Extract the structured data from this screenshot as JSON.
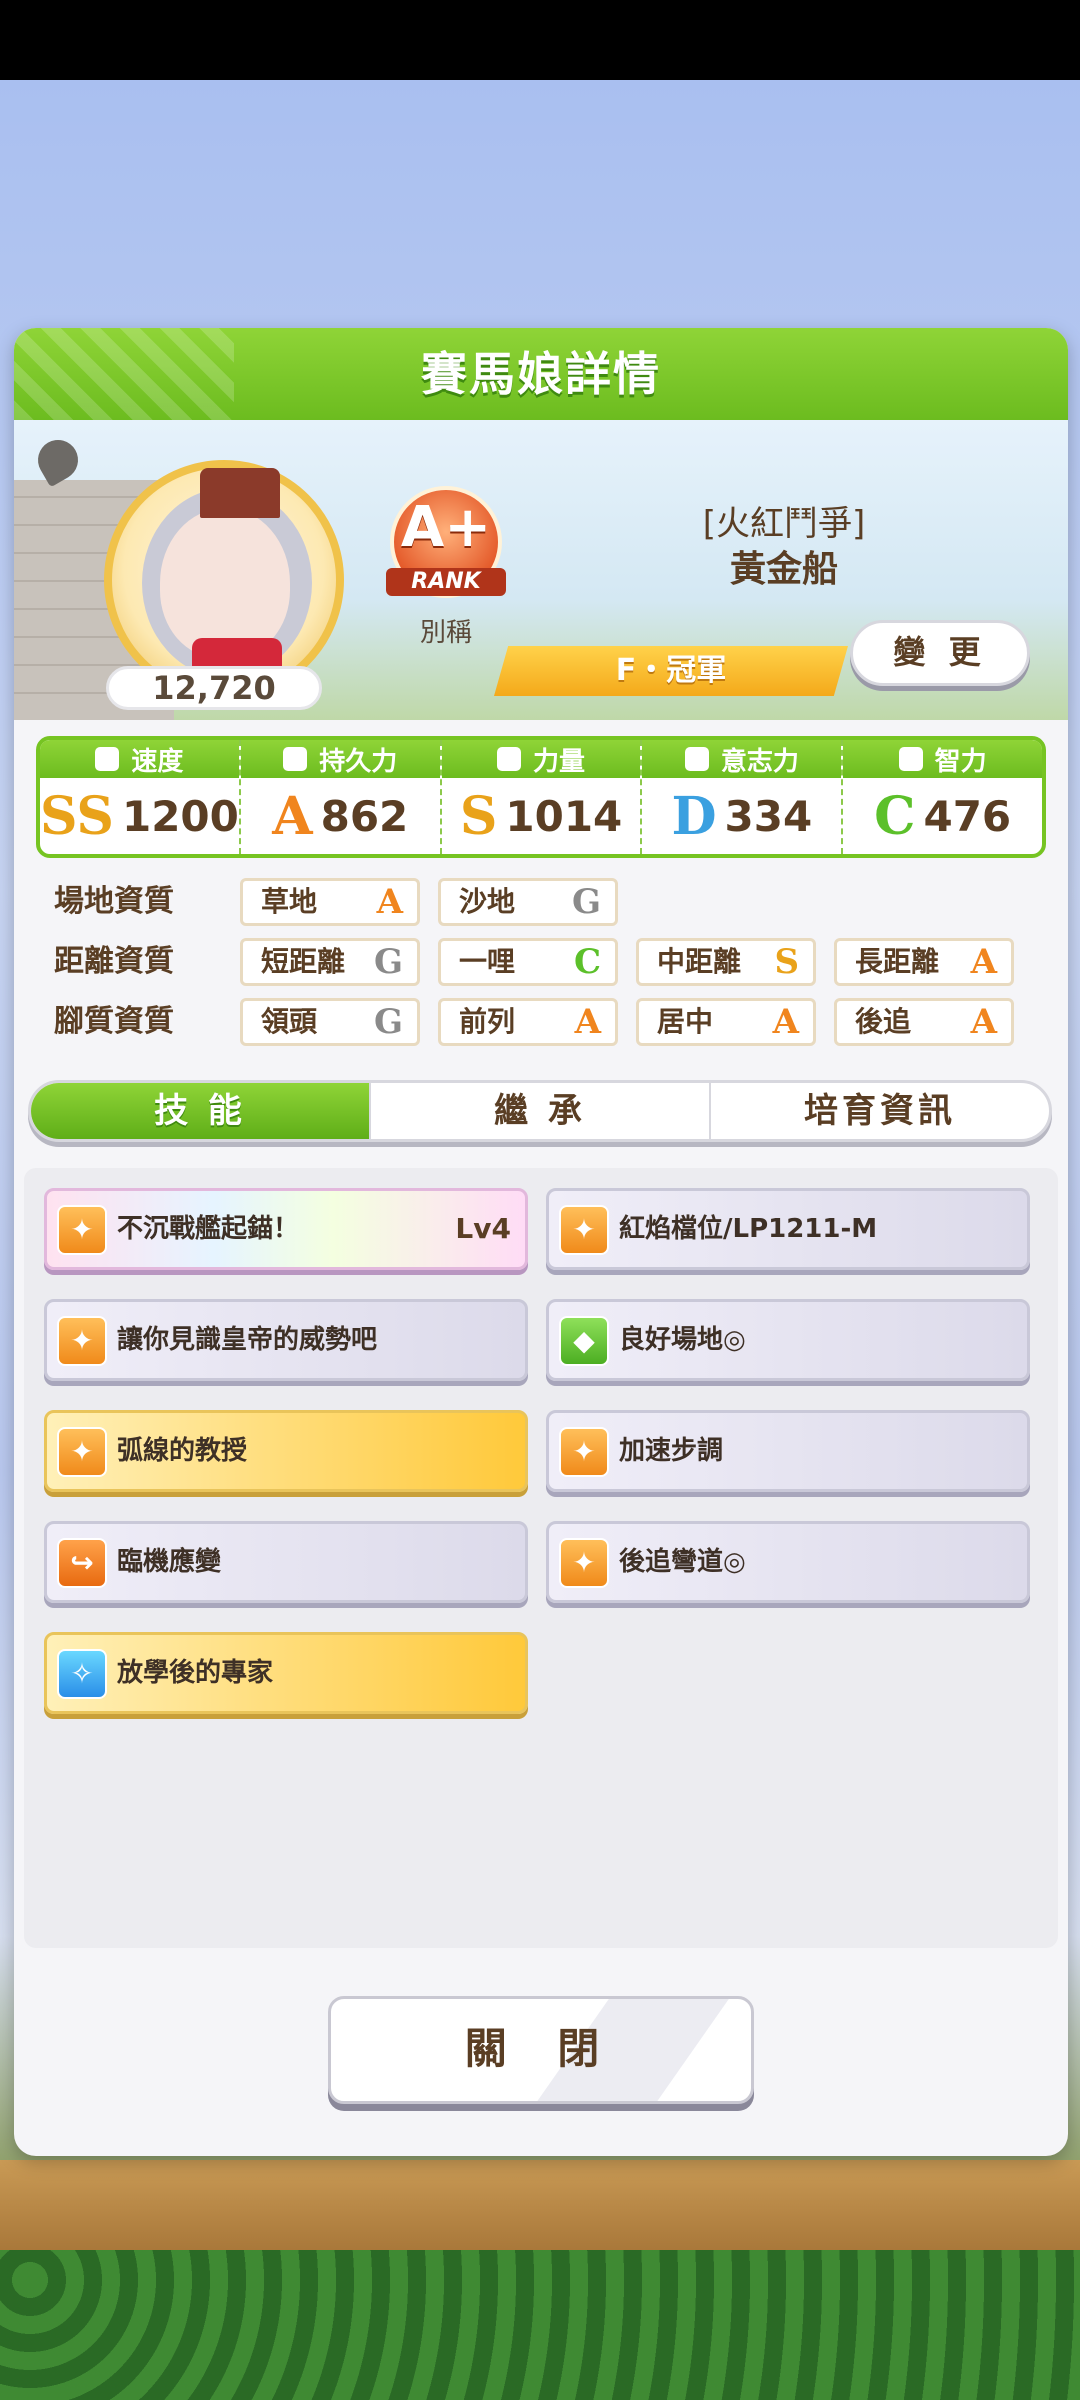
{
  "dialog": {
    "title": "賽馬娘詳情",
    "character": {
      "score": "12,720",
      "rank_grade": "A+",
      "rank_word": "RANK",
      "rank_label": "別稱",
      "epithet": "[火紅鬥爭]",
      "name": "黃金船",
      "title_badge": "F・冠軍",
      "change_button": "變 更"
    },
    "stats": [
      {
        "name": "速度",
        "grade": "SS",
        "value": "1200",
        "grade_color": "#e9a21a",
        "icon": "shoe-icon"
      },
      {
        "name": "持久力",
        "grade": "A",
        "value": "862",
        "grade_color": "#f0851e",
        "icon": "heart-icon"
      },
      {
        "name": "力量",
        "grade": "S",
        "value": "1014",
        "grade_color": "#e9a21a",
        "icon": "muscle-icon"
      },
      {
        "name": "意志力",
        "grade": "D",
        "value": "334",
        "grade_color": "#3aa0e0",
        "icon": "flame-icon"
      },
      {
        "name": "智力",
        "grade": "C",
        "value": "476",
        "grade_color": "#5cc02a",
        "icon": "graduation-cap-icon"
      }
    ],
    "aptitudes": {
      "field": {
        "label": "場地資質",
        "items": [
          {
            "name": "草地",
            "grade": "A"
          },
          {
            "name": "沙地",
            "grade": "G"
          }
        ]
      },
      "distance": {
        "label": "距離資質",
        "items": [
          {
            "name": "短距離",
            "grade": "G"
          },
          {
            "name": "一哩",
            "grade": "C"
          },
          {
            "name": "中距離",
            "grade": "S"
          },
          {
            "name": "長距離",
            "grade": "A"
          }
        ]
      },
      "style": {
        "label": "腳質資質",
        "items": [
          {
            "name": "領頭",
            "grade": "G"
          },
          {
            "name": "前列",
            "grade": "A"
          },
          {
            "name": "居中",
            "grade": "A"
          },
          {
            "name": "後追",
            "grade": "A"
          }
        ]
      }
    },
    "grade_colors": {
      "A": "#f0851e",
      "G": "#8a8a8a",
      "C": "#5cc02a",
      "S": "#e9a21a"
    },
    "tabs": [
      "技 能",
      "繼 承",
      "培育資訊"
    ],
    "skills": [
      {
        "name": "不沉戰艦起錨！",
        "level": "Lv4",
        "style": "rainbow",
        "icon": "runner-icon"
      },
      {
        "name": "紅焰檔位/LP1211-M",
        "level": "",
        "style": "normal",
        "icon": "runner-icon"
      },
      {
        "name": "讓你見識皇帝的威勢吧",
        "level": "",
        "style": "normal",
        "icon": "runner-icon"
      },
      {
        "name": "良好場地◎",
        "level": "",
        "style": "normal",
        "icon": "muscle-icon"
      },
      {
        "name": "弧線的教授",
        "level": "",
        "style": "gold",
        "icon": "runner-icon"
      },
      {
        "name": "加速步調",
        "level": "",
        "style": "normal",
        "icon": "runner-icon"
      },
      {
        "name": "臨機應變",
        "level": "",
        "style": "normal",
        "icon": "arrow-turn-icon"
      },
      {
        "name": "後追彎道◎",
        "level": "",
        "style": "normal",
        "icon": "runner-icon"
      },
      {
        "name": "放學後的專家",
        "level": "",
        "style": "gold",
        "icon": "sparkle-icon"
      }
    ],
    "close_button": "關 閉"
  }
}
